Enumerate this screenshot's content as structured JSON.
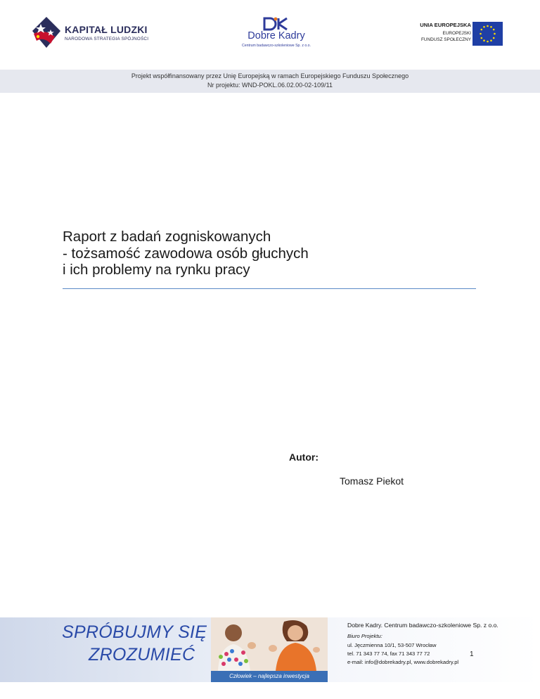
{
  "header": {
    "kapital_ludzki": {
      "title": "KAPITAŁ LUDZKI",
      "subtitle": "NARODOWA STRATEGIA SPÓJNOŚCI"
    },
    "dobre_kadry": {
      "mark": "DK",
      "name": "Dobre Kadry",
      "subtitle": "Centrum badawczo-szkoleniowe Sp. z o.o."
    },
    "eu": {
      "line1": "UNIA EUROPEJSKA",
      "line2": "EUROPEJSKI",
      "line3": "FUNDUSZ SPOŁECZNY"
    }
  },
  "band": {
    "line1": "Projekt współfinansowany przez Unię Europejską w ramach Europejskiego Funduszu Społecznego",
    "line2": "Nr projektu: WND-POKL.06.02.00-02-109/11"
  },
  "title": {
    "lines": [
      "Raport z badań zogniskowanych",
      "- tożsamość zawodowa osób głuchych",
      "i ich problemy na rynku pracy"
    ]
  },
  "author": {
    "label": "Autor:",
    "name": "Tomasz Piekot"
  },
  "footer": {
    "slogan_line1": "SPRÓBUJMY SIĘ",
    "slogan_line2": "ZROZUMIEĆ",
    "photo_caption": "Człowiek – najlepsza inwestycja",
    "company": "Dobre Kadry. Centrum badawczo-szkoleniowe  Sp. z o.o.",
    "office_label": "Biuro Projektu:",
    "street": "ul. Jęczmienna 10/1, 53-507 Wrocław",
    "tel": "tel. 71 343 77 74, fax 71 343 77 72",
    "email": "e-mail: info@dobrekadry.pl, www.dobrekadry.pl",
    "page_number": "1"
  },
  "colors": {
    "kl_navy": "#2b2e5c",
    "dk_blue": "#2e3b9a",
    "eu_blue": "#1f3fa5",
    "eu_star": "#ffdd00",
    "band_bg": "#e6e8ef",
    "title_rule": "#5b8ac6",
    "slogan_blue": "#2a4aa8",
    "caption_bg": "#3a6fb6"
  }
}
